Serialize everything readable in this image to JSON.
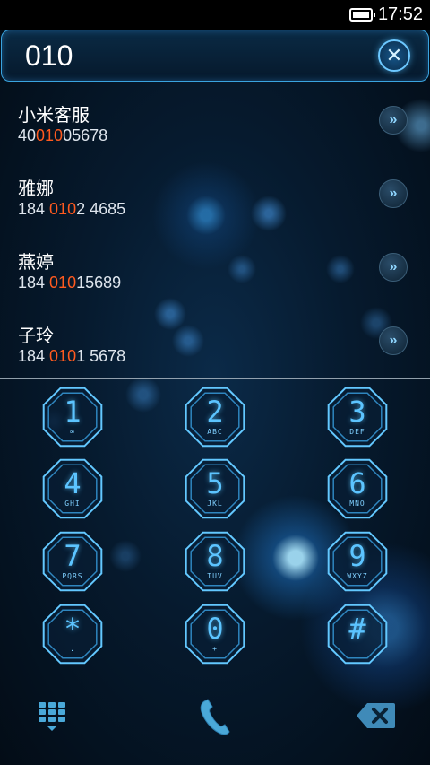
{
  "status": {
    "time": "17:52",
    "battery_icon": "battery-icon"
  },
  "search": {
    "query": "010",
    "clear_icon": "close-icon"
  },
  "results": [
    {
      "name": "小米客服",
      "pre": "40",
      "hl": "010",
      "post": "05678"
    },
    {
      "name": "雅娜",
      "pre": "184 ",
      "hl": "010",
      "post": "2 4685"
    },
    {
      "name": "燕婷",
      "pre": "184 ",
      "hl": "010",
      "post": "15689"
    },
    {
      "name": "子玲",
      "pre": "184 ",
      "hl": "010",
      "post": "1 5678"
    }
  ],
  "keys": [
    {
      "digit": "1",
      "sub": "∞"
    },
    {
      "digit": "2",
      "sub": "ABC"
    },
    {
      "digit": "3",
      "sub": "DEF"
    },
    {
      "digit": "4",
      "sub": "GHI"
    },
    {
      "digit": "5",
      "sub": "JKL"
    },
    {
      "digit": "6",
      "sub": "MNO"
    },
    {
      "digit": "7",
      "sub": "PQRS"
    },
    {
      "digit": "8",
      "sub": "TUV"
    },
    {
      "digit": "9",
      "sub": "WXYZ"
    },
    {
      "digit": "*",
      "sub": "."
    },
    {
      "digit": "0",
      "sub": "+"
    },
    {
      "digit": "#",
      "sub": ""
    }
  ],
  "colors": {
    "accent": "#5cc4ff",
    "highlight": "#ff5a1f"
  },
  "bottom": {
    "dialpad_icon": "dialpad-icon",
    "call_icon": "phone-icon",
    "backspace_icon": "backspace-icon"
  }
}
